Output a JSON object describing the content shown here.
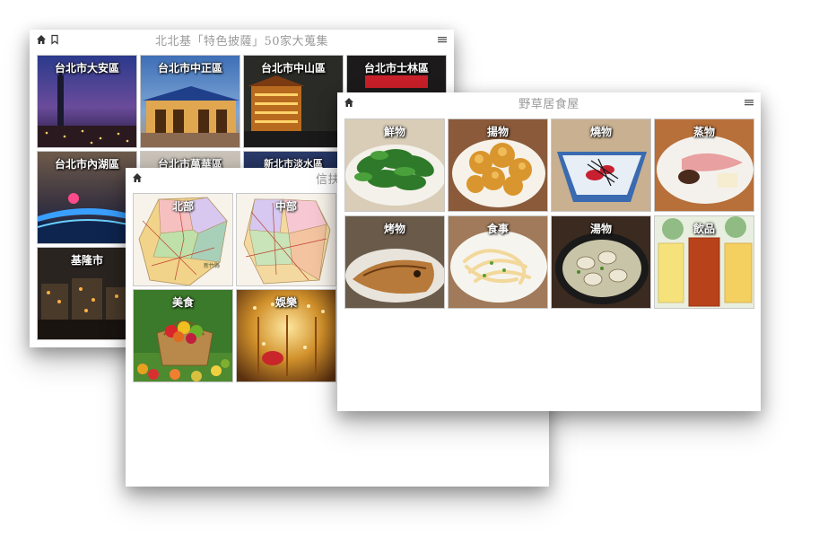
{
  "panel_a": {
    "title": "北北基「特色披薩」50家大蒐集",
    "tiles": [
      {
        "label": "台北市大安區"
      },
      {
        "label": "台北市中正區"
      },
      {
        "label": "台北市中山區"
      },
      {
        "label": "台北市士林區"
      },
      {
        "label": "台北市內湖區"
      },
      {
        "label": "台北市萬華區"
      },
      {
        "label": "新北市淡水區"
      },
      {
        "label": "基隆市"
      }
    ]
  },
  "panel_b": {
    "title": "信扶",
    "tiles": [
      {
        "label": "北部"
      },
      {
        "label": "中部"
      },
      {
        "label": "美食"
      },
      {
        "label": "娛樂"
      }
    ],
    "map_label": "新竹縣"
  },
  "panel_c": {
    "title": "野草居食屋",
    "tiles": [
      {
        "label": "鮮物"
      },
      {
        "label": "揚物"
      },
      {
        "label": "燒物"
      },
      {
        "label": "蒸物"
      },
      {
        "label": "烤物"
      },
      {
        "label": "食事"
      },
      {
        "label": "湯物"
      },
      {
        "label": "飲品"
      }
    ]
  },
  "icons": [
    "home-icon",
    "bookmark-icon",
    "menu-icon"
  ]
}
